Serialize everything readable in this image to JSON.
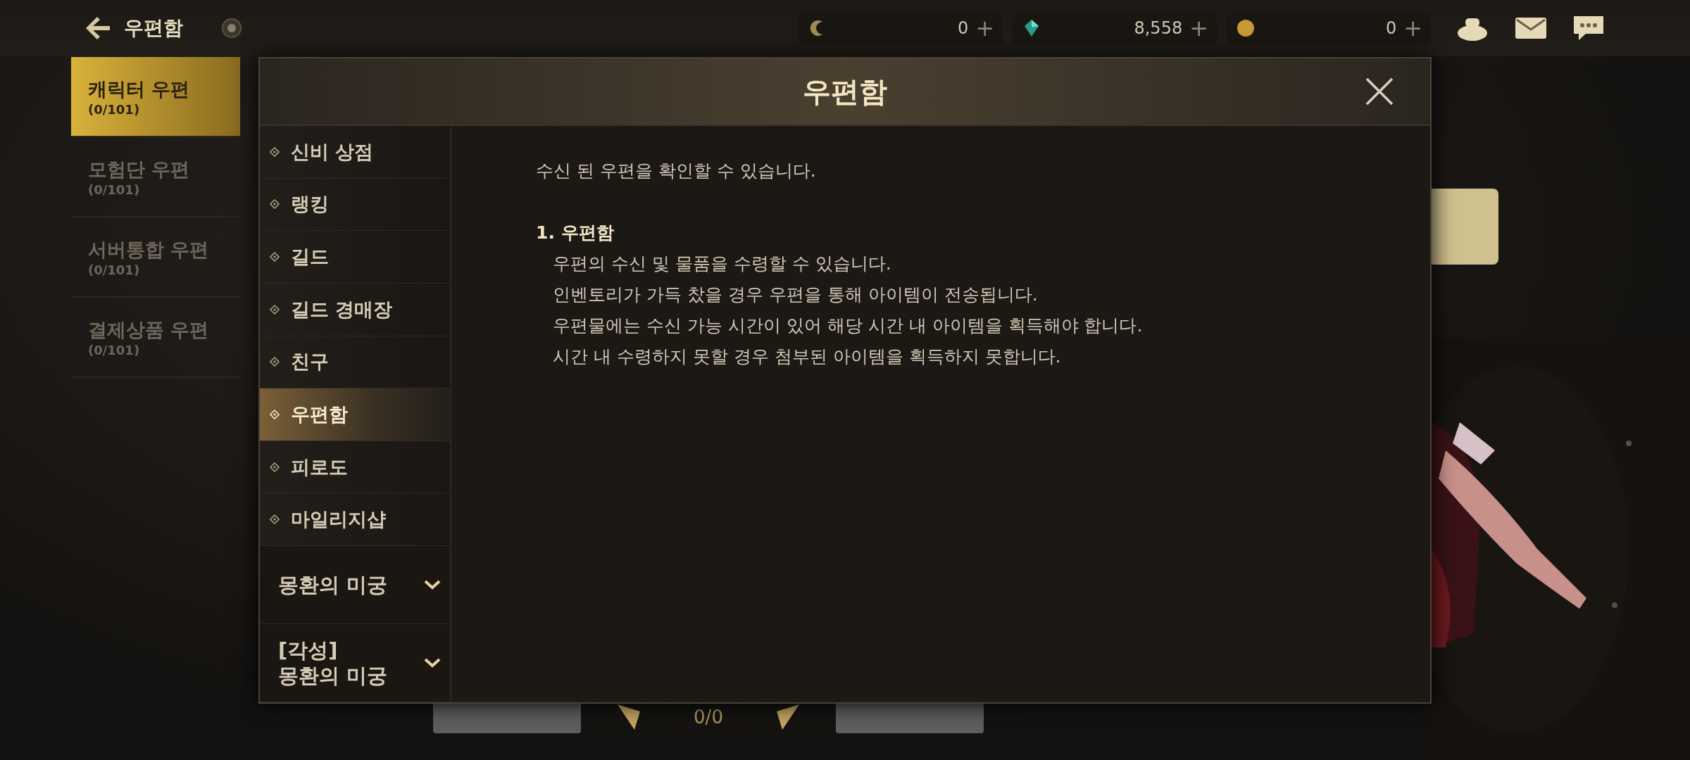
{
  "top_bar": {
    "title": "우편함",
    "currencies": [
      {
        "kind": "coin-c",
        "amount": "0",
        "add": "+"
      },
      {
        "kind": "gem",
        "amount": "8,558",
        "add": "+"
      },
      {
        "kind": "gold",
        "amount": "0",
        "add": "+"
      }
    ]
  },
  "mailbox_tabs": [
    {
      "name": "캐릭터 우편",
      "count": "(0/101)",
      "selected": true
    },
    {
      "name": "모험단 우편",
      "count": "(0/101)",
      "selected": false
    },
    {
      "name": "서버통합 우편",
      "count": "(0/101)",
      "selected": false
    },
    {
      "name": "결제상품 우편",
      "count": "(0/101)",
      "selected": false
    }
  ],
  "pager": "0/0",
  "dialog": {
    "title": "우편함",
    "menu": [
      {
        "kind": "item",
        "label": "신비 상점",
        "selected": false
      },
      {
        "kind": "item",
        "label": "랭킹",
        "selected": false
      },
      {
        "kind": "item",
        "label": "길드",
        "selected": false
      },
      {
        "kind": "item",
        "label": "길드 경매장",
        "selected": false
      },
      {
        "kind": "item",
        "label": "친구",
        "selected": false
      },
      {
        "kind": "item",
        "label": "우편함",
        "selected": true
      },
      {
        "kind": "item",
        "label": "피로도",
        "selected": false
      },
      {
        "kind": "item",
        "label": "마일리지샵",
        "selected": false
      },
      {
        "kind": "group",
        "label": "몽환의 미궁",
        "expanded": false
      },
      {
        "kind": "group",
        "label": "[각성]\n몽환의 미궁",
        "expanded": false
      }
    ],
    "content": {
      "intro": "수신 된 우편을 확인할 수 있습니다.",
      "sections": [
        {
          "heading": "1. 우편함",
          "lines": [
            "우편의 수신 및 물품을 수령할 수 있습니다.",
            "인벤토리가 가득 찼을 경우 우편을 통해 아이템이 전송됩니다.",
            "우편물에는 수신 가능 시간이 있어 해당 시간 내 아이템을 획득해야 합니다.",
            "시간 내 수령하지 못할 경우 첨부된 아이템을 획득하지 못합니다."
          ]
        }
      ]
    }
  }
}
